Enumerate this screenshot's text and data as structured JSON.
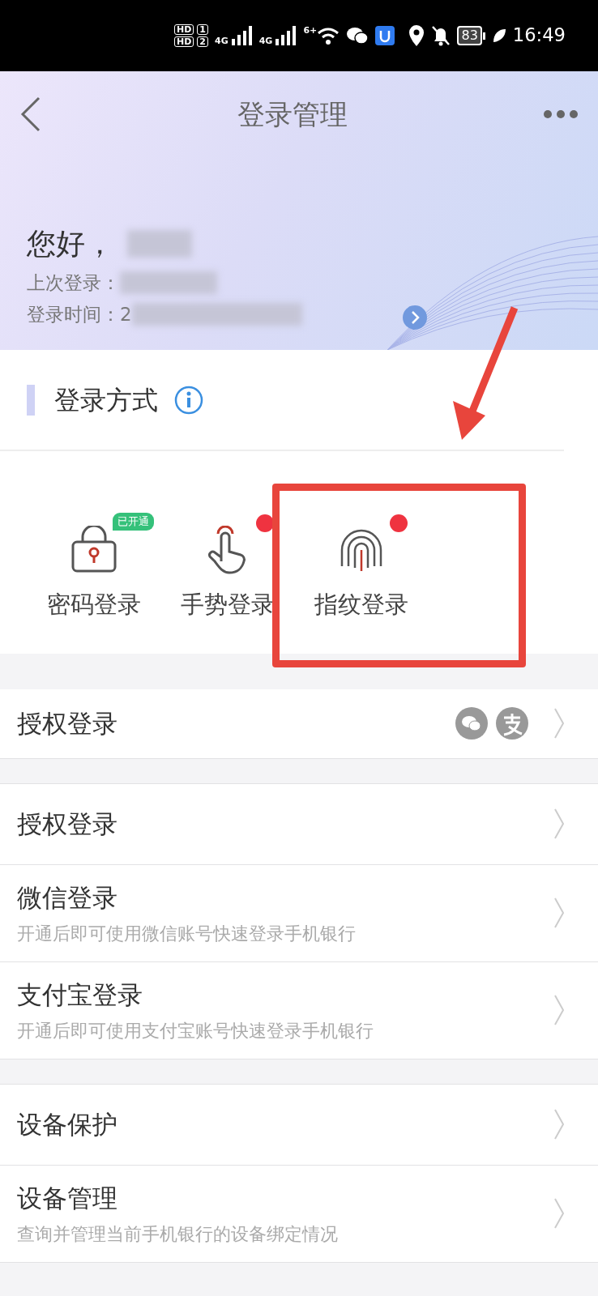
{
  "status_bar": {
    "sims": [
      {
        "label": "HD",
        "slot": "1"
      },
      {
        "label": "HD",
        "slot": "2"
      }
    ],
    "networks": [
      "4G",
      "4G"
    ],
    "wifi": "6+",
    "battery": "83",
    "time": "16:49"
  },
  "header": {
    "title": "登录管理"
  },
  "profile": {
    "greeting": "您好，",
    "last_login_label": "上次登录：",
    "login_time_label": "登录时间：2"
  },
  "section": {
    "title": "登录方式"
  },
  "methods": [
    {
      "kind": "lock",
      "label": "密码登录",
      "badge": "已开通",
      "new": false
    },
    {
      "kind": "gesture",
      "label": "手势登录",
      "new": true
    },
    {
      "kind": "fingerprint",
      "label": "指纹登录",
      "new": true
    }
  ],
  "groups": [
    [
      {
        "title": "授权登录",
        "apps": true
      }
    ],
    [
      {
        "title": "授权登录"
      },
      {
        "title": "微信登录",
        "subtitle": "开通后即可使用微信账号快速登录手机银行"
      },
      {
        "title": "支付宝登录",
        "subtitle": "开通后即可使用支付宝账号快速登录手机银行"
      }
    ],
    [
      {
        "title": "设备保护"
      },
      {
        "title": "设备管理",
        "subtitle": "查询并管理当前手机银行的设备绑定情况"
      }
    ]
  ]
}
